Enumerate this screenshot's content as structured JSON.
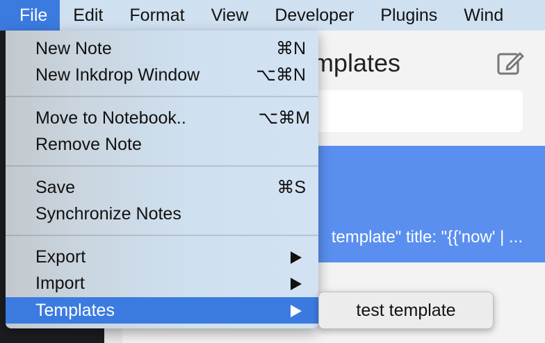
{
  "menubar": {
    "items": [
      "File",
      "Edit",
      "Format",
      "View",
      "Developer",
      "Plugins",
      "Wind"
    ],
    "active": "File"
  },
  "background": {
    "panel_title": "Templates",
    "note_snippet": "template\" title: \"{{'now' | ...",
    "accent": "#5a8ff0"
  },
  "file_menu": {
    "new_note": {
      "label": "New Note",
      "shortcut": "⌘N"
    },
    "new_window": {
      "label": "New Inkdrop Window",
      "shortcut": "⌥⌘N"
    },
    "move_to_notebook": {
      "label": "Move to Notebook..",
      "shortcut": "⌥⌘M"
    },
    "remove_note": {
      "label": "Remove Note"
    },
    "save": {
      "label": "Save",
      "shortcut": "⌘S"
    },
    "synchronize": {
      "label": "Synchronize Notes"
    },
    "export": {
      "label": "Export"
    },
    "import": {
      "label": "Import"
    },
    "templates": {
      "label": "Templates"
    },
    "highlight_color": "#3b7be0"
  },
  "templates_submenu": {
    "items": [
      "test template"
    ]
  },
  "icons": [
    "edit-note-icon",
    "submenu-arrow-icon"
  ]
}
